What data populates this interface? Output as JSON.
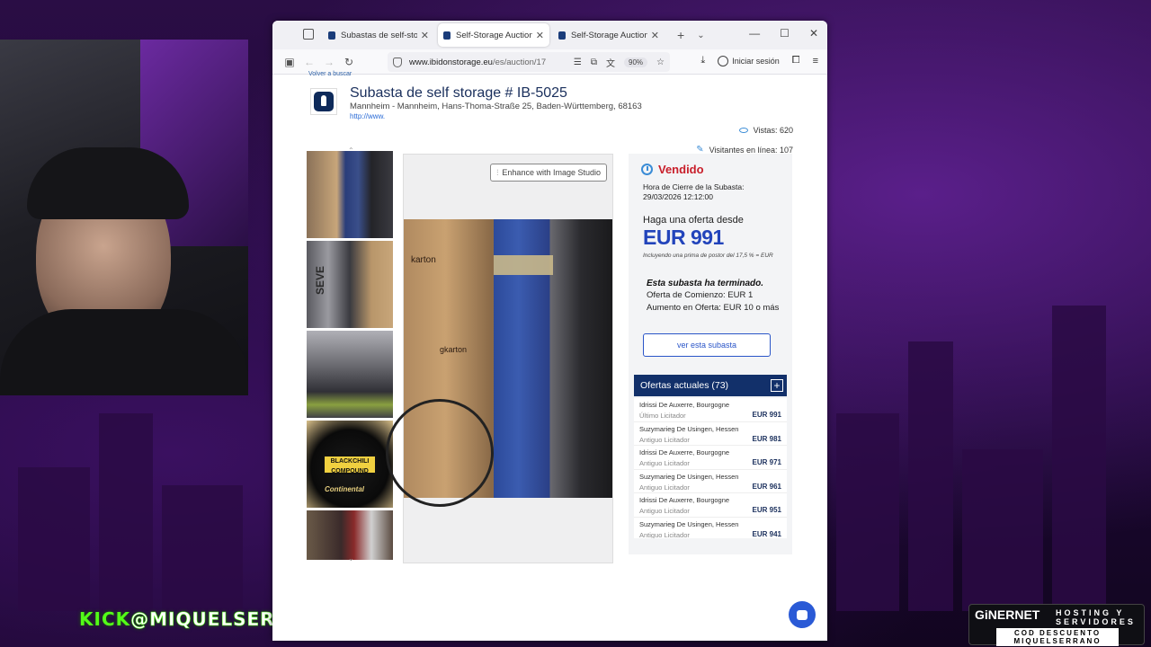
{
  "overlay": {
    "kick_label": "KICK",
    "kick_handle": "@MIQUELSERRA",
    "sponsor_brand": "GiNERNET",
    "sponsor_tag": "HOSTING Y SERVIDORES",
    "sponsor_code": "COD DESCUENTO MIQUELSERRANO"
  },
  "browser": {
    "tabs": [
      {
        "title": "Subastas de self-storage",
        "active": false
      },
      {
        "title": "Self-Storage Auction IB",
        "active": true
      },
      {
        "title": "Self-Storage Auction IB",
        "active": false
      }
    ],
    "url_domain": "www.ibidonstorage.eu",
    "url_path": "/es/auction/17",
    "zoom": "90%",
    "signin_label": "Iniciar sesión"
  },
  "page": {
    "back_link": "Volver a buscar",
    "title": "Subasta de self storage # IB-5025",
    "address": "Mannheim - Mannheim, Hans-Thoma-Straße 25, Baden-Württemberg, 68163",
    "web": "http://www.",
    "views": "Vistas: 620",
    "online": "Visitantes en línea: 107",
    "enhance_label": "Enhance with Image Studio",
    "thumb_labels": {
      "brand1": "BLACKCHILI COMPOUND",
      "brand2": "Continental",
      "side": "SEVE"
    },
    "img_labels": {
      "karton1": "karton",
      "karton2": "gkarton"
    }
  },
  "side": {
    "status": "Vendido",
    "close_label": "Hora de Cierre de la Subasta:",
    "close_time": "29/03/2026 12:12:00",
    "offer_from": "Haga una oferta desde",
    "price": "EUR 991",
    "premium": "Incluyendo una prima de postor del 17,5 % = EUR",
    "ended": "Esta subasta ha terminado.",
    "start": "Oferta de Comienzo: EUR 1",
    "increment": "Aumento en Oferta: EUR 10 o más",
    "view_button": "ver esta subasta",
    "bids_title": "Ofertas actuales (73)",
    "bids": [
      {
        "who": "Idrissi De Auxerre, Bourgogne",
        "role": "Último Licitador",
        "amount": "EUR 991"
      },
      {
        "who": "Suzymarieg De Usingen, Hessen",
        "role": "Antiguo Licitador",
        "amount": "EUR 981"
      },
      {
        "who": "Idrissi De Auxerre, Bourgogne",
        "role": "Antiguo Licitador",
        "amount": "EUR 971"
      },
      {
        "who": "Suzymarieg De Usingen, Hessen",
        "role": "Antiguo Licitador",
        "amount": "EUR 961"
      },
      {
        "who": "Idrissi De Auxerre, Bourgogne",
        "role": "Antiguo Licitador",
        "amount": "EUR 951"
      },
      {
        "who": "Suzymarieg De Usingen, Hessen",
        "role": "Antiguo Licitador",
        "amount": "EUR 941"
      }
    ]
  }
}
